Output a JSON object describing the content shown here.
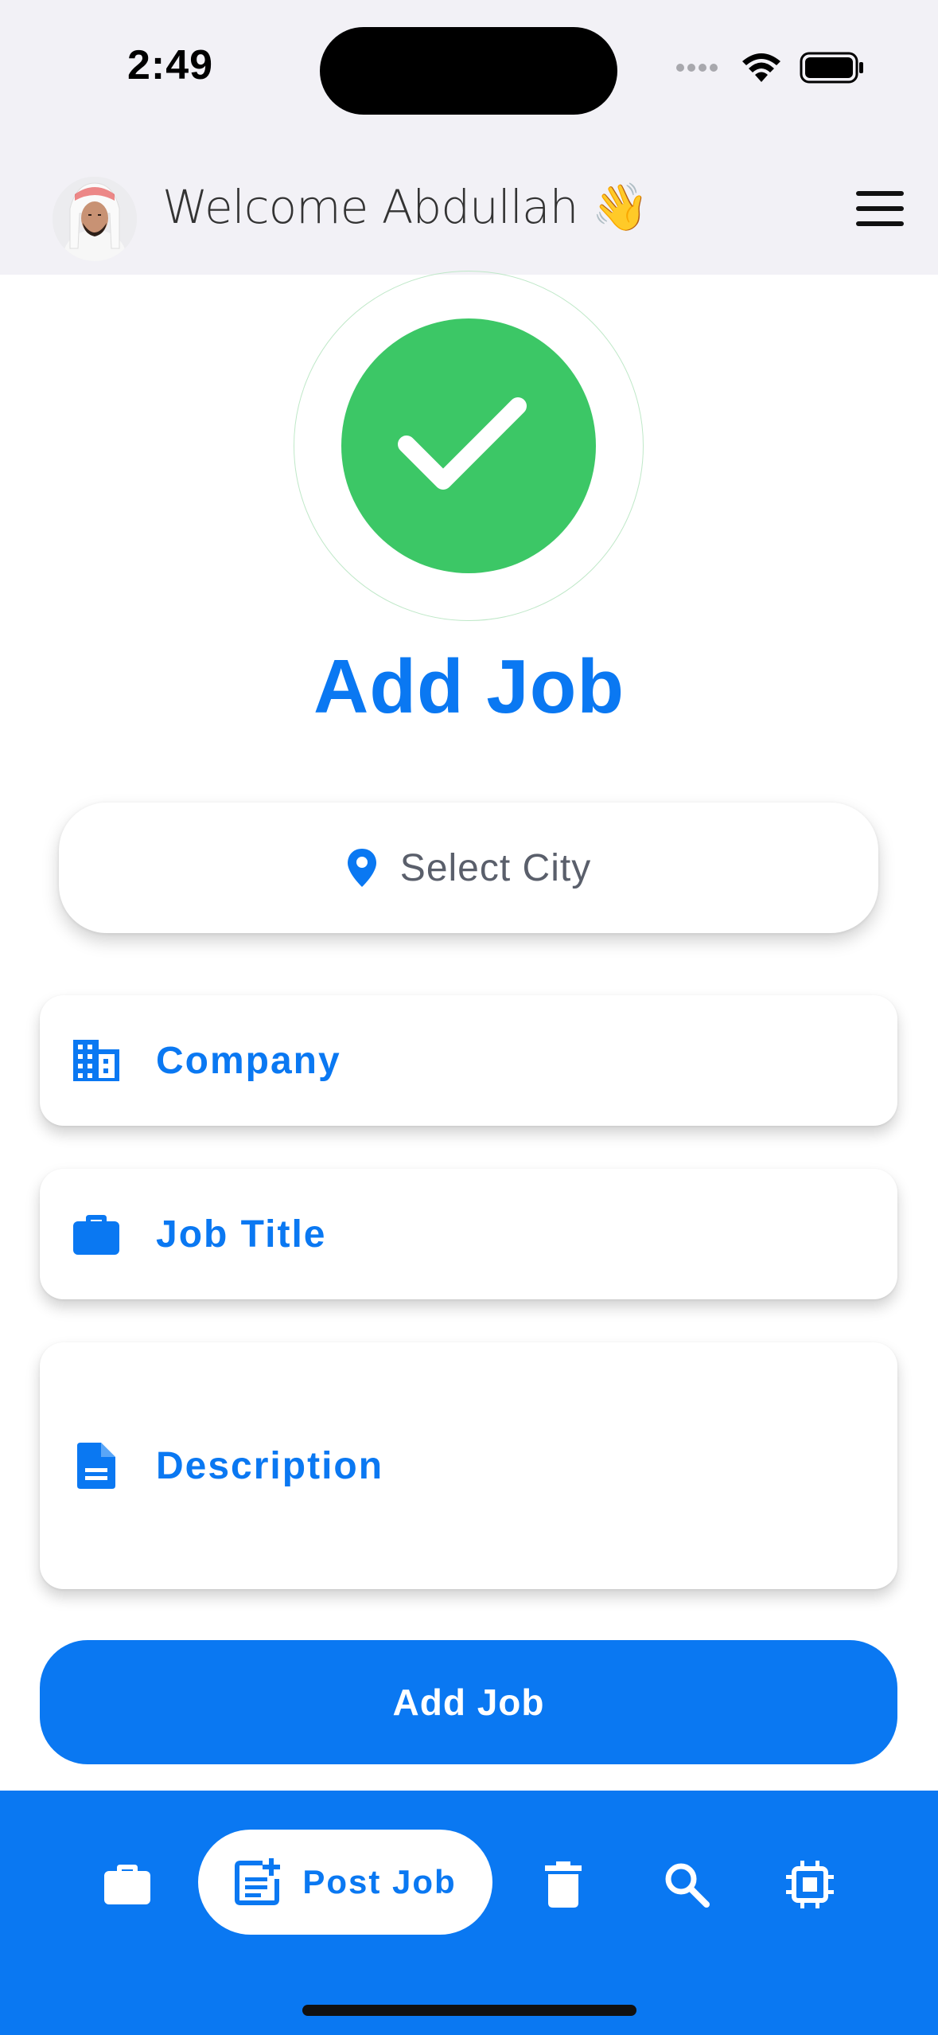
{
  "status_bar": {
    "time": "2:49"
  },
  "header": {
    "welcome": "Welcome Abdullah 👋"
  },
  "page": {
    "title": "Add Job"
  },
  "form": {
    "city_placeholder": "Select City",
    "company_placeholder": "Company",
    "job_title_placeholder": "Job Title",
    "description_placeholder": "Description",
    "submit_label": "Add Job"
  },
  "bottom_nav": {
    "active_label": "Post Job",
    "items": [
      "jobs",
      "post-job",
      "delete",
      "search",
      "settings"
    ]
  },
  "colors": {
    "accent": "#0a78f2",
    "success": "#3cc766",
    "header_bg": "#f2f1f6"
  }
}
